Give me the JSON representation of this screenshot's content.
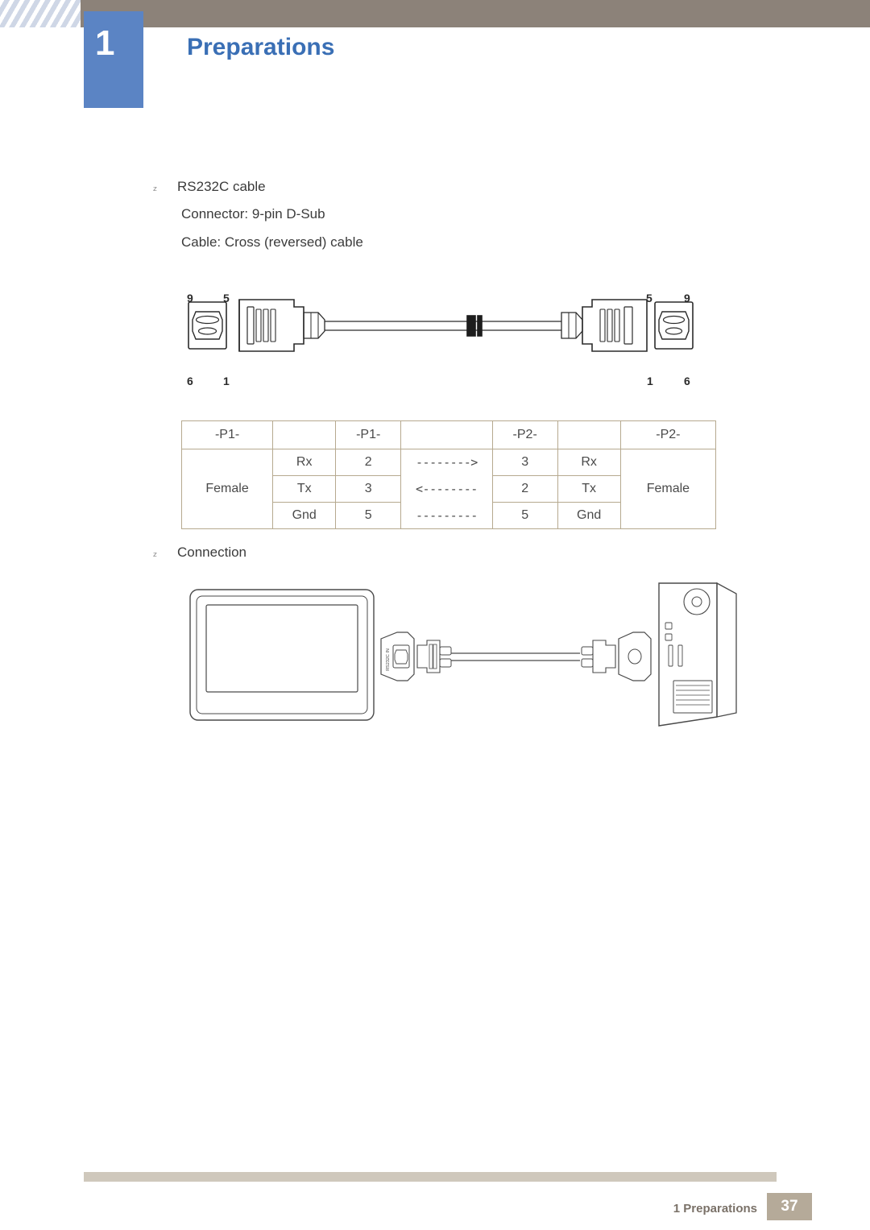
{
  "header": {
    "chapter_number": "1",
    "chapter_title": "Preparations"
  },
  "content": {
    "bullet_marker": "z",
    "items": [
      {
        "label": "RS232C cable"
      },
      {
        "label": "Connection"
      }
    ],
    "cable_specs": [
      "Connector: 9-pin D-Sub",
      "Cable: Cross (reversed) cable"
    ],
    "connector_pin_labels": {
      "left_top_outer": "9",
      "left_top_inner": "5",
      "left_bottom_outer": "6",
      "left_bottom_inner": "1",
      "right_top_inner": "5",
      "right_top_outer": "9",
      "right_bottom_inner": "1",
      "right_bottom_outer": "6"
    }
  },
  "pin_table": {
    "header": [
      "-P1-",
      "",
      "-P1-",
      "",
      "-P2-",
      "",
      "-P2-"
    ],
    "rows": [
      {
        "side_left": "Female",
        "signal_left": "Rx",
        "pin_left": "2",
        "direction": "-------->",
        "pin_right": "3",
        "signal_right": "Rx",
        "side_right": "Female"
      },
      {
        "side_left": "",
        "signal_left": "Tx",
        "pin_left": "3",
        "direction": "<--------",
        "pin_right": "2",
        "signal_right": "Tx",
        "side_right": ""
      },
      {
        "side_left": "",
        "signal_left": "Gnd",
        "pin_left": "5",
        "direction": "---------",
        "pin_right": "5",
        "signal_right": "Gnd",
        "side_right": ""
      }
    ]
  },
  "diagram": {
    "port_label": "RS232C IN"
  },
  "footer": {
    "text": "1 Preparations",
    "page": "37"
  },
  "colors": {
    "header_band": "#8c8279",
    "chapter_box": "#5b84c4",
    "title_blue": "#3a6fb5",
    "table_border": "#b6a98f",
    "footer_band": "#cfc8bc",
    "footer_page_bg": "#b5aa99"
  }
}
